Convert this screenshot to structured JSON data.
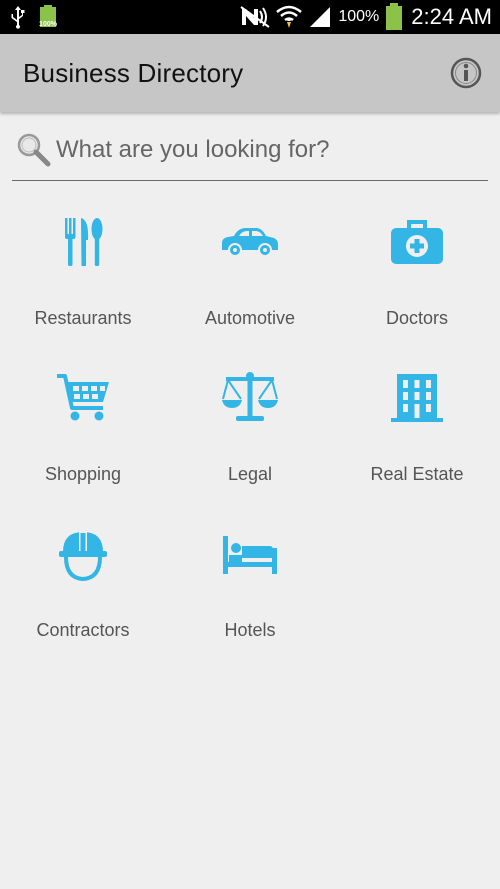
{
  "status_bar": {
    "battery_small_label": "100%",
    "battery_percent": "100%",
    "time": "2:24 AM"
  },
  "action_bar": {
    "title": "Business Directory",
    "info_icon": "info-icon"
  },
  "search": {
    "placeholder": "What are you looking for?",
    "value": ""
  },
  "colors": {
    "icon_blue": "#33b5e5",
    "action_bar_bg": "#c6c6c6",
    "background": "#efefef"
  },
  "categories": [
    {
      "label": "Restaurants",
      "icon": "fork-knife-spoon-icon"
    },
    {
      "label": "Automotive",
      "icon": "car-icon"
    },
    {
      "label": "Doctors",
      "icon": "medical-kit-icon"
    },
    {
      "label": "Shopping",
      "icon": "shopping-cart-icon"
    },
    {
      "label": "Legal",
      "icon": "scales-icon"
    },
    {
      "label": "Real Estate",
      "icon": "building-icon"
    },
    {
      "label": "Contractors",
      "icon": "hard-hat-icon"
    },
    {
      "label": "Hotels",
      "icon": "bed-icon"
    }
  ]
}
